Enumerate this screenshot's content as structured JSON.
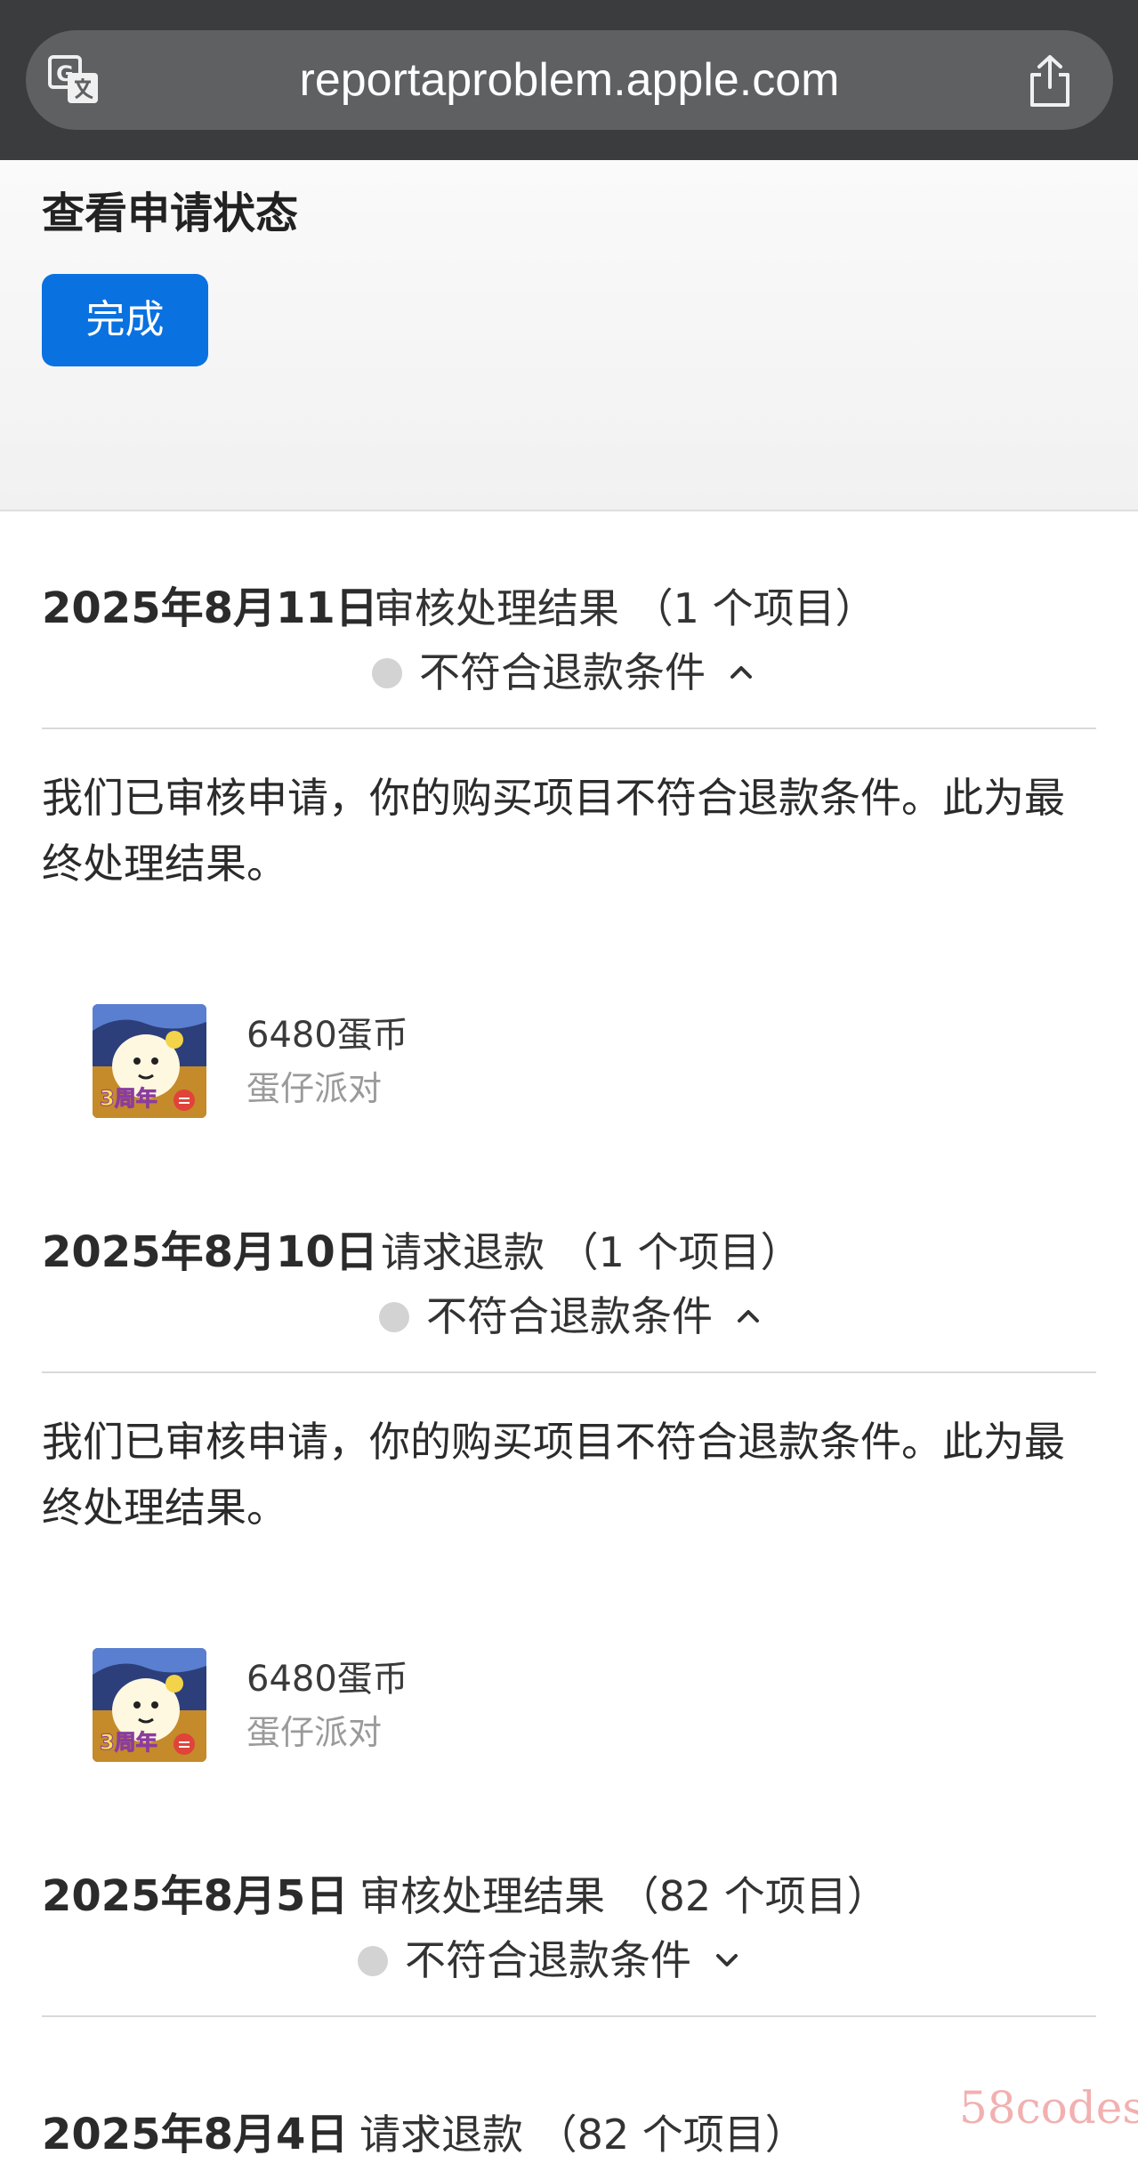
{
  "browser": {
    "url": "reportaproblem.apple.com",
    "translate_icon": "translate-icon",
    "share_icon": "share-icon"
  },
  "header": {
    "title": "查看申请状态",
    "done_label": "完成"
  },
  "records": [
    {
      "date": "2025年8月11日",
      "type": "审核处理结果 （1 个项目）",
      "status": "不符合退款条件",
      "expanded": true,
      "description": "我们已审核申请，你的购买项目不符合退款条件。此为最终处理结果。",
      "item": {
        "name": "6480蛋币",
        "app": "蛋仔派对",
        "badge": "3周年"
      }
    },
    {
      "date": "2025年8月10日",
      "type": "请求退款 （1 个项目）",
      "status": "不符合退款条件",
      "expanded": true,
      "description": "我们已审核申请，你的购买项目不符合退款条件。此为最终处理结果。",
      "item": {
        "name": "6480蛋币",
        "app": "蛋仔派对",
        "badge": "3周年"
      }
    },
    {
      "date": "2025年8月5日",
      "type": "审核处理结果 （82 个项目）",
      "status": "不符合退款条件",
      "expanded": false
    },
    {
      "date": "2025年8月4日",
      "type": "请求退款 （82 个项目）"
    }
  ],
  "watermark": "58codes",
  "colors": {
    "accent": "#0a71e1",
    "status_dot": "#d3d3d3",
    "address_bar": "#3b3c3e"
  }
}
